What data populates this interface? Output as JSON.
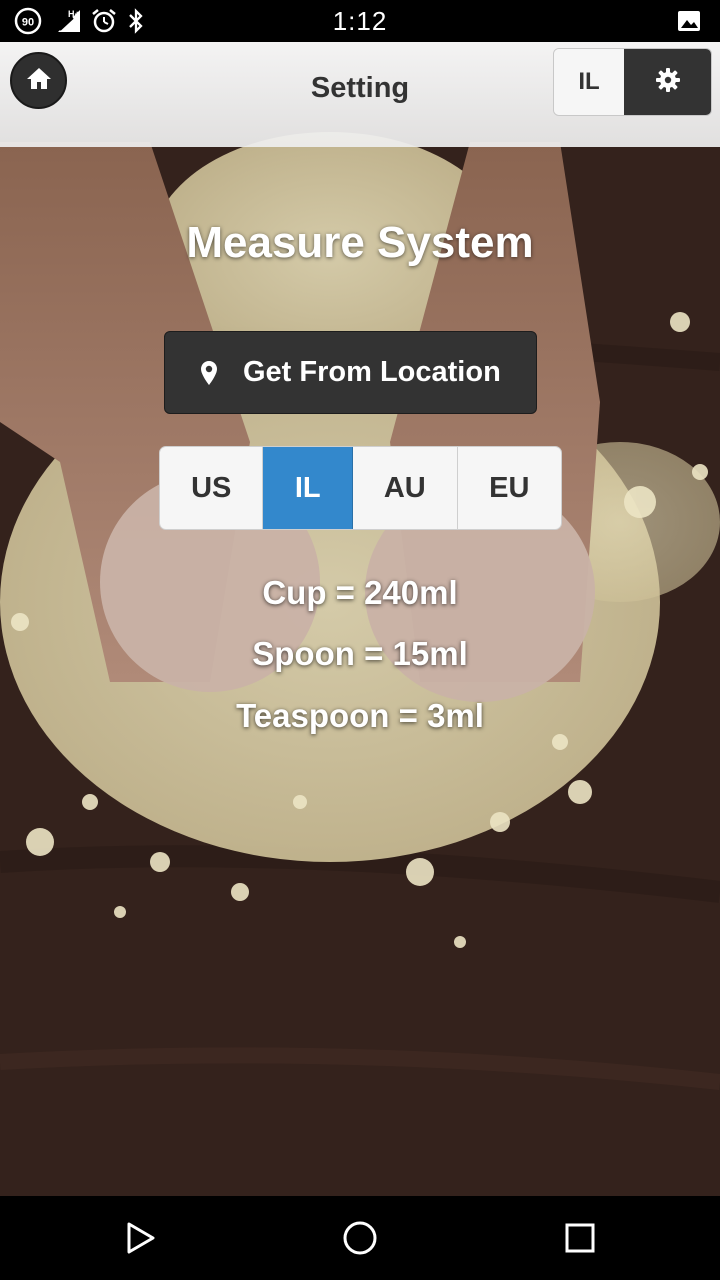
{
  "status_bar": {
    "time": "1:12",
    "badge_90": "90",
    "network_label": "H+",
    "icons": [
      "data-saver-icon",
      "signal-icon",
      "alarm-icon",
      "bluetooth-icon",
      "image-notification-icon"
    ]
  },
  "header": {
    "title": "Setting",
    "current_system": "IL",
    "home_icon": "home-icon",
    "settings_icon": "gear-icon"
  },
  "content": {
    "title": "Measure System",
    "location_button": "Get From Location",
    "location_icon": "map-pin-icon",
    "systems": [
      {
        "label": "US",
        "selected": false
      },
      {
        "label": "IL",
        "selected": true
      },
      {
        "label": "AU",
        "selected": false
      },
      {
        "label": "EU",
        "selected": false
      }
    ],
    "measurements": [
      "Cup = 240ml",
      "Spoon = 15ml",
      "Teaspoon = 3ml"
    ]
  },
  "colors": {
    "accent": "#3388cc",
    "button_dark": "#333333",
    "header_bg": "#f2f2f2"
  },
  "nav_bar": {
    "icons": [
      "back-icon",
      "home-circle-icon",
      "recents-icon"
    ]
  }
}
